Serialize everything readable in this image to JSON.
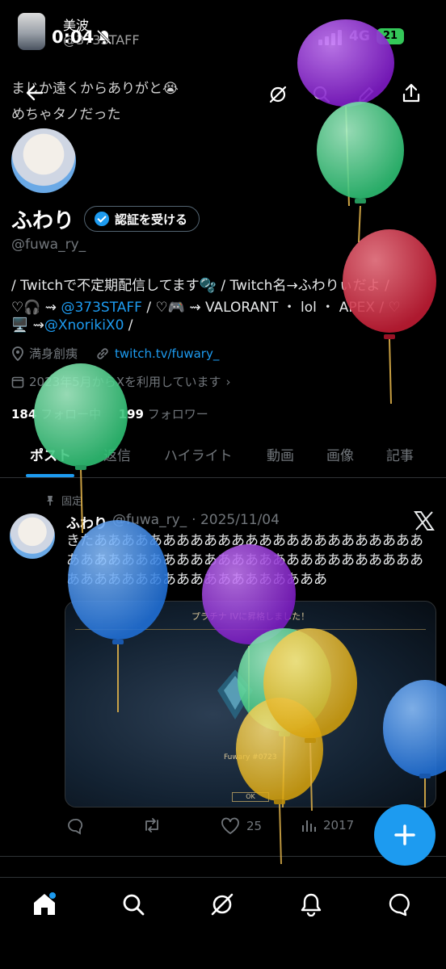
{
  "status_bar": {
    "time": "0:04",
    "account_name": "美波",
    "account_handle": "@373STAFF",
    "network": "4G",
    "battery": "21"
  },
  "header": {
    "overlay_text_line1": "まじか遠くからありがと😭",
    "overlay_text_line2": "めちゃタノだった",
    "icons": [
      "back-arrow-icon",
      "grok-icon",
      "search-icon",
      "compose-icon",
      "share-icon"
    ]
  },
  "profile": {
    "display_name": "ふわり",
    "verify_label": "認証を受ける",
    "handle": "@fuwa_ry_",
    "bio_line1_a": "/ Twitchで不定期配信してます🫧 / Twitch名→ふわりぃだよ /",
    "bio_line2_a": "♡🎧 ⇝ ",
    "bio_line2_link": "@373STAFF",
    "bio_line2_b": " / ♡🎮 ⇝ VALORANT ・ lol ・ APEX / ♡",
    "bio_line3_a": "🖥️ ⇝",
    "bio_line3_link": "@XnorikiX0",
    "bio_line3_b": " /",
    "location": "満身創痍",
    "website": "twitch.tv/fuwary_",
    "joined": "2023年5月からXを利用しています",
    "following_count": "184",
    "following_label": "フォロー中",
    "followers_count": "199",
    "followers_label": "フォロワー"
  },
  "tabs": [
    "ポスト",
    "返信",
    "ハイライト",
    "動画",
    "画像",
    "記事"
  ],
  "post": {
    "pinned_label": "固定",
    "author": "ふわり",
    "handle": "@fuwa_ry_",
    "date": "· 2025/11/04",
    "text": "きたあああああああああああああああああああああああああああああああああああああああああああああああああああああああああああああああああああああ",
    "media_title": "プラチナ IVに昇格しました！",
    "media_player": "Fuwary #0723",
    "media_button": "OK",
    "replies": "",
    "retweets": "",
    "likes": "25",
    "views": "2017"
  },
  "nav": [
    "home-icon",
    "explore-icon",
    "grok-icon",
    "notifications-icon",
    "messages-icon"
  ],
  "colors": {
    "accent": "#1d9bf0",
    "background": "#000000",
    "muted": "#71767b",
    "balloon_purple": "#9b2de0",
    "balloon_green": "#4fd98f",
    "balloon_red": "#e0344a",
    "balloon_blue": "#3a8ef0",
    "balloon_yellow": "#f0c419"
  }
}
